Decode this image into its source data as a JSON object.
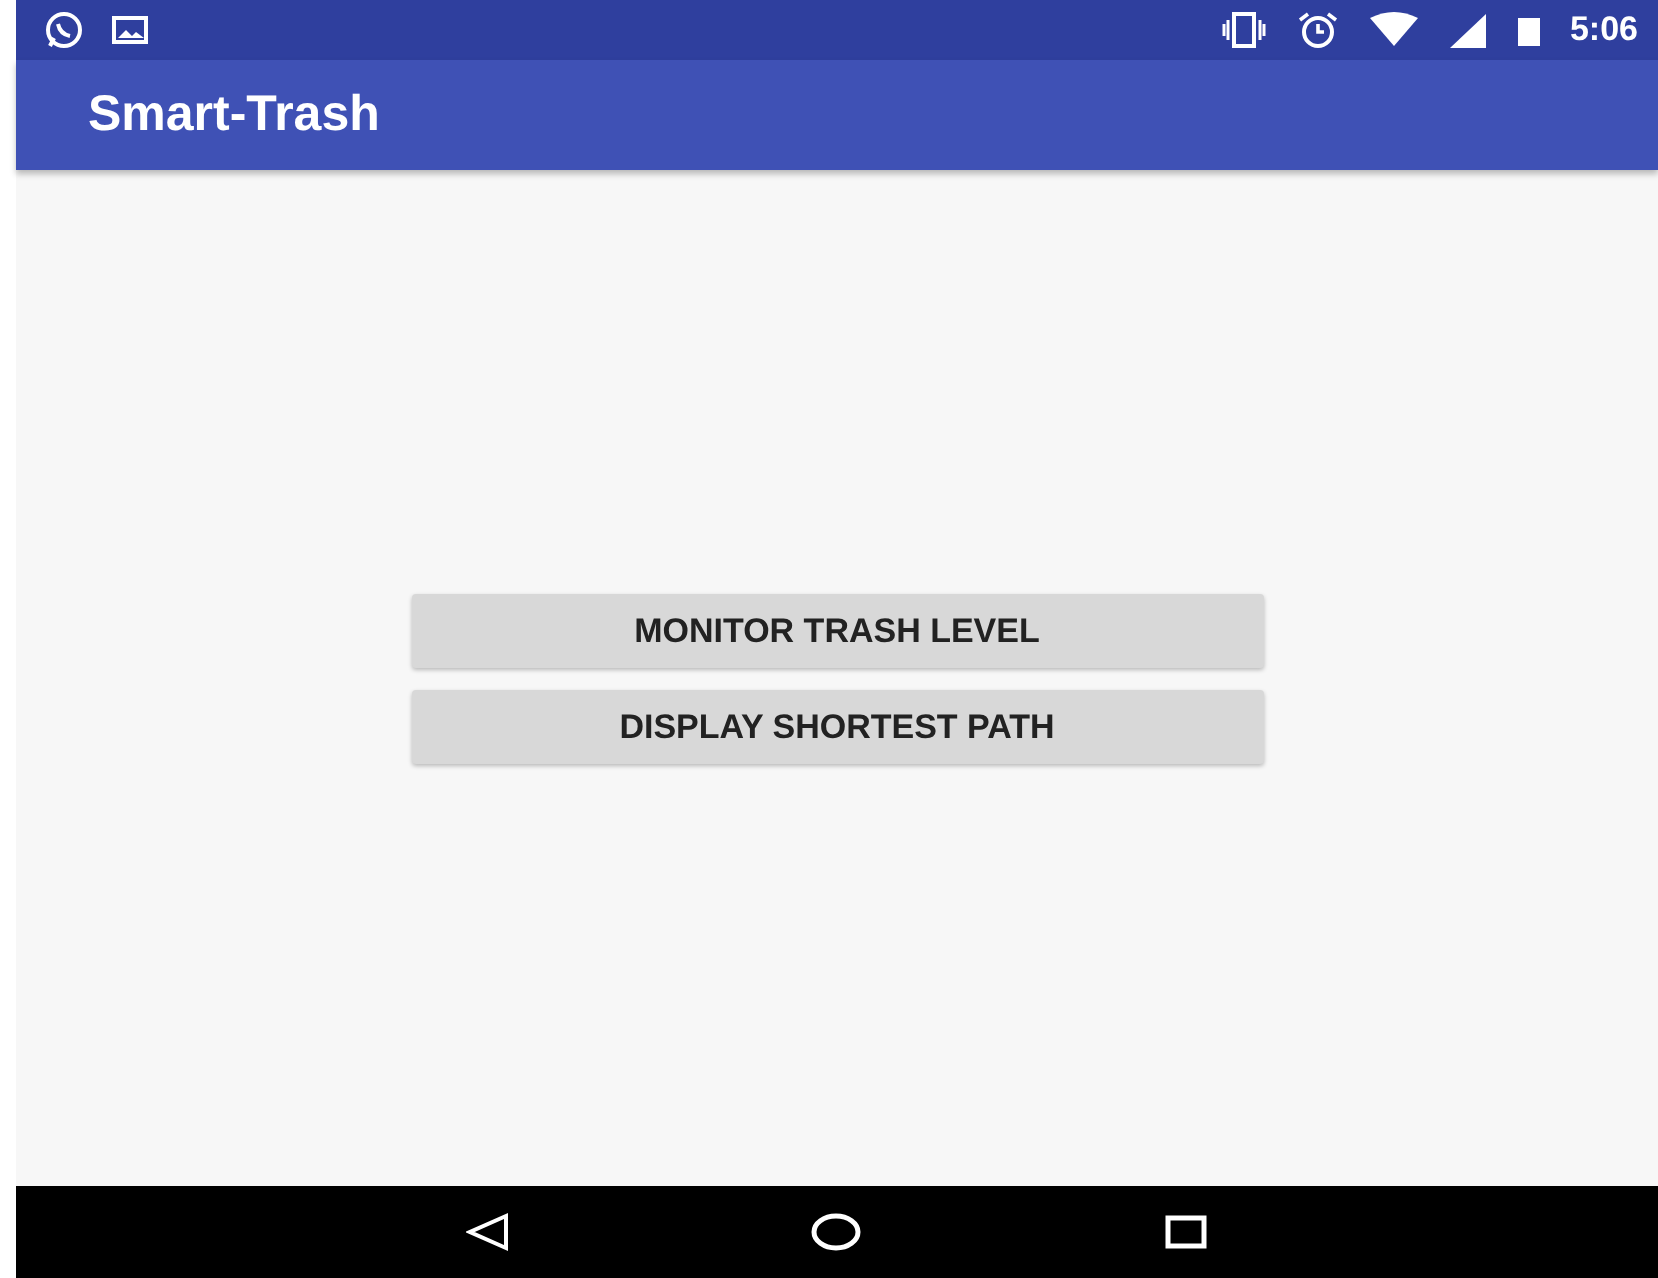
{
  "status_bar": {
    "time": "5:06"
  },
  "app_bar": {
    "title": "Smart-Trash"
  },
  "buttons": [
    {
      "label": "MONITOR TRASH LEVEL"
    },
    {
      "label": "DISPLAY SHORTEST PATH"
    }
  ]
}
